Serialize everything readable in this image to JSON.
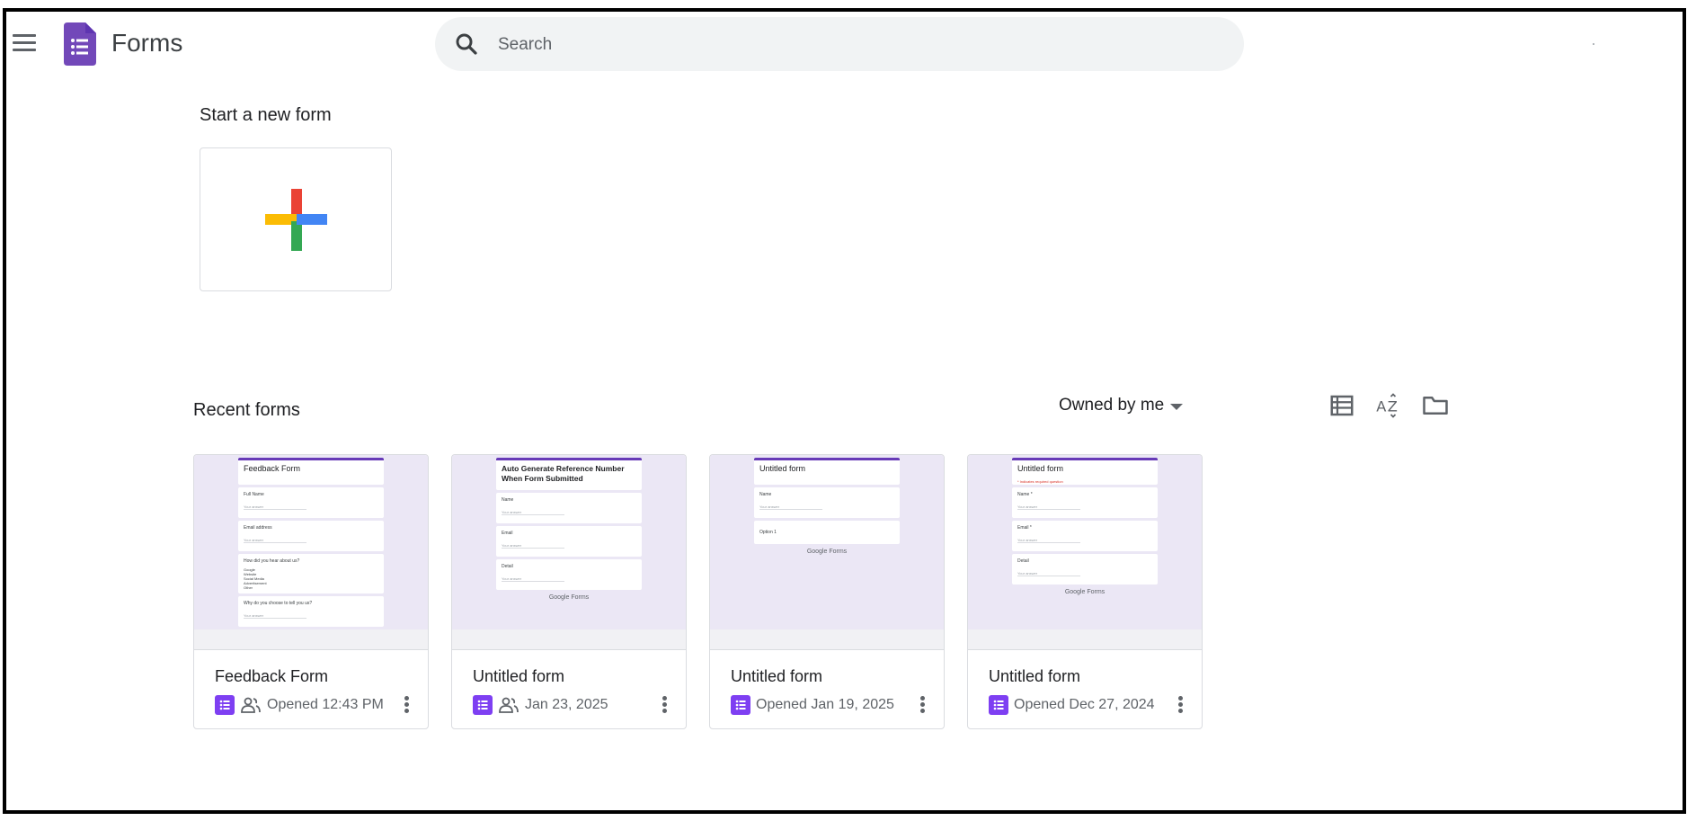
{
  "app": {
    "name": "Forms"
  },
  "search": {
    "placeholder": "Search"
  },
  "start_section": {
    "title": "Start a new form"
  },
  "recent_section": {
    "title": "Recent forms",
    "owner_filter": "Owned by me"
  },
  "colors": {
    "brand": "#7e3ff2",
    "accent_top": "#673ab7",
    "thumb_bg": "#ebe7f5"
  },
  "recent_forms": [
    {
      "title": "Feedback Form",
      "date": "Opened 12:43 PM",
      "shared": true,
      "thumb": {
        "header": "Feedback Form",
        "questions": [
          "Full Name",
          "Email address",
          "How did you hear about us?",
          "Why do you choose to tell you us?"
        ],
        "answer": "Your answer",
        "options": [
          "Google",
          "Website",
          "Social Media",
          "Advertisement",
          "Other"
        ]
      }
    },
    {
      "title": "Untitled form",
      "date": "Jan 23, 2025",
      "shared": true,
      "thumb": {
        "header": "Auto Generate Reference Number When Form Submitted",
        "questions": [
          "Name",
          "Email",
          "Detail"
        ],
        "answer": "Your answer",
        "footer": "Google Forms"
      }
    },
    {
      "title": "Untitled form",
      "date": "Opened Jan 19, 2025",
      "shared": false,
      "thumb": {
        "header": "Untitled form",
        "questions": [
          "Name",
          "Option 1"
        ],
        "answer": "Your answer",
        "footer": "Google Forms"
      }
    },
    {
      "title": "Untitled form",
      "date": "Opened Dec 27, 2024",
      "shared": false,
      "thumb": {
        "header": "Untitled form",
        "required_note": "* Indicates required question",
        "questions": [
          "Name *",
          "Email *",
          "Detail"
        ],
        "answer": "Your answer",
        "footer": "Google Forms"
      }
    }
  ],
  "icons": {
    "menu": "hamburger-menu-icon",
    "search": "search-icon",
    "list_view": "list-view-icon",
    "sort": "sort-az-icon",
    "folder": "folder-icon",
    "more": "more-vert-icon",
    "people": "people-icon"
  }
}
